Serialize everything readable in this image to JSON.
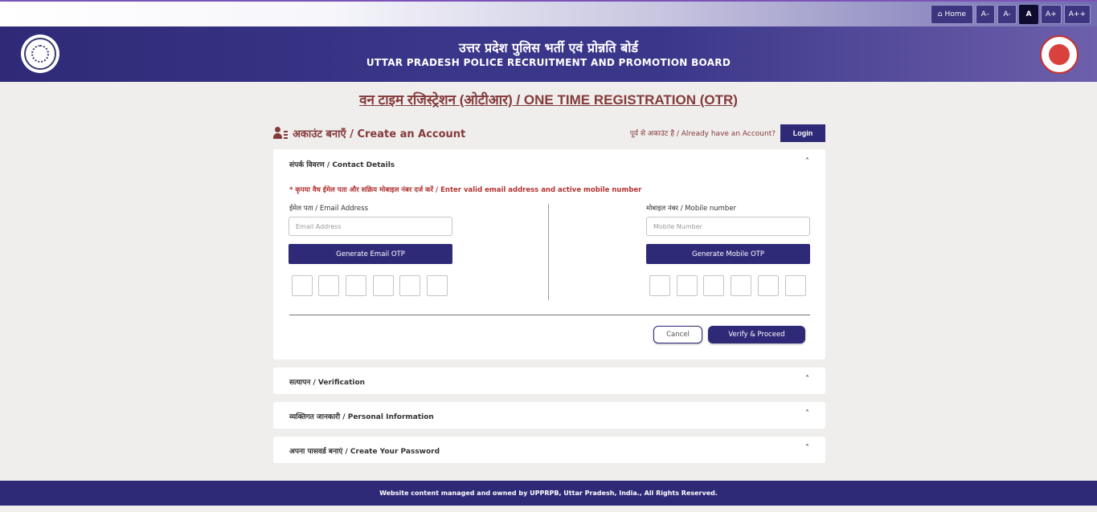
{
  "accessibility": {
    "home_label": "Home",
    "font_buttons": [
      "A–",
      "A-",
      "A",
      "A+",
      "A++"
    ]
  },
  "header": {
    "title_hi": "उत्तर प्रदेश पुलिस भर्ती एवं प्रोन्नति बोर्ड",
    "title_en": "UTTAR PRADESH POLICE RECRUITMENT AND PROMOTION BOARD"
  },
  "page": {
    "title": "वन टाइम रजिस्ट्रेशन (ओटीआर) / ONE TIME REGISTRATION (OTR)",
    "create_account": "अकाउंट बनाएँ / Create an Account",
    "already_have": "पूर्व से अकाउंट है / Already have an Account?",
    "login_label": "Login"
  },
  "contact": {
    "heading": "संपर्क विवरण / Contact Details",
    "note": "* कृपया वैध ईमेल पता और सक्रिय मोबाइल नंबर दर्ज करें / Enter valid email address and active mobile number",
    "email_label": "ईमेल पता / Email Address",
    "email_placeholder": "Email Address",
    "email_otp_label": "Generate Email OTP",
    "mobile_label": "मोबाइल नंबर / Mobile number",
    "mobile_placeholder": "Mobile Number",
    "mobile_otp_label": "Generate Mobile OTP",
    "cancel_label": "Cancel",
    "verify_label": "Verify & Proceed"
  },
  "sections": {
    "verification": "सत्यापन / Verification",
    "personal": "व्यक्तिगत जानकारी / Personal Information",
    "password": "अपना पासवर्ड बनाएं / Create Your Password"
  },
  "icons": {
    "chevron": "chevron-up-icon",
    "home": "home-icon",
    "user": "user-list-icon"
  },
  "colors": {
    "brand": "#2e2a78",
    "accent_text": "#843a3a",
    "note": "#b23232"
  },
  "footer": {
    "text": "Website content managed and owned by UPPRPB, Uttar Pradesh, India., All Rights Reserved."
  }
}
